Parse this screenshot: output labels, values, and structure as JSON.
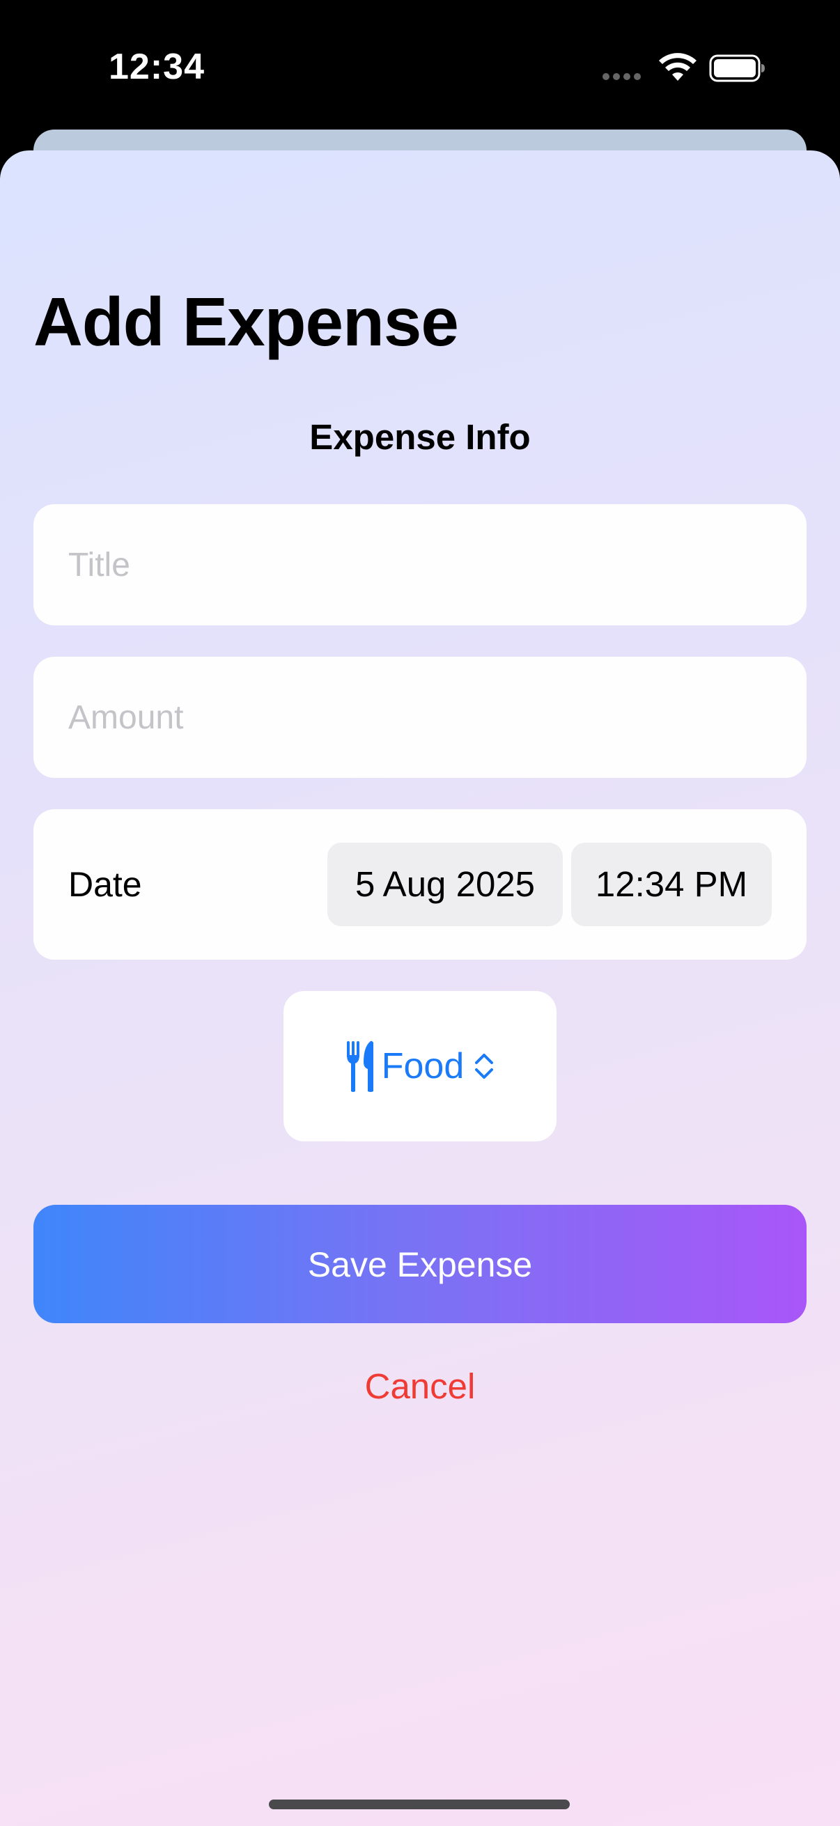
{
  "status_bar": {
    "time": "12:34"
  },
  "sheet": {
    "title": "Add Expense",
    "section_header": "Expense Info",
    "title_field": {
      "placeholder": "Title",
      "value": ""
    },
    "amount_field": {
      "placeholder": "Amount",
      "value": ""
    },
    "date_row": {
      "label": "Date",
      "date_value": "5 Aug 2025",
      "time_value": "12:34 PM"
    },
    "category": {
      "selected": "Food",
      "icon": "fork-knife-icon"
    },
    "save_label": "Save Expense",
    "cancel_label": "Cancel"
  },
  "colors": {
    "accent": "#1a7af8",
    "cancel": "#ef3b34",
    "save_gradient_start": "#3f86fa",
    "save_gradient_end": "#a956f8"
  }
}
